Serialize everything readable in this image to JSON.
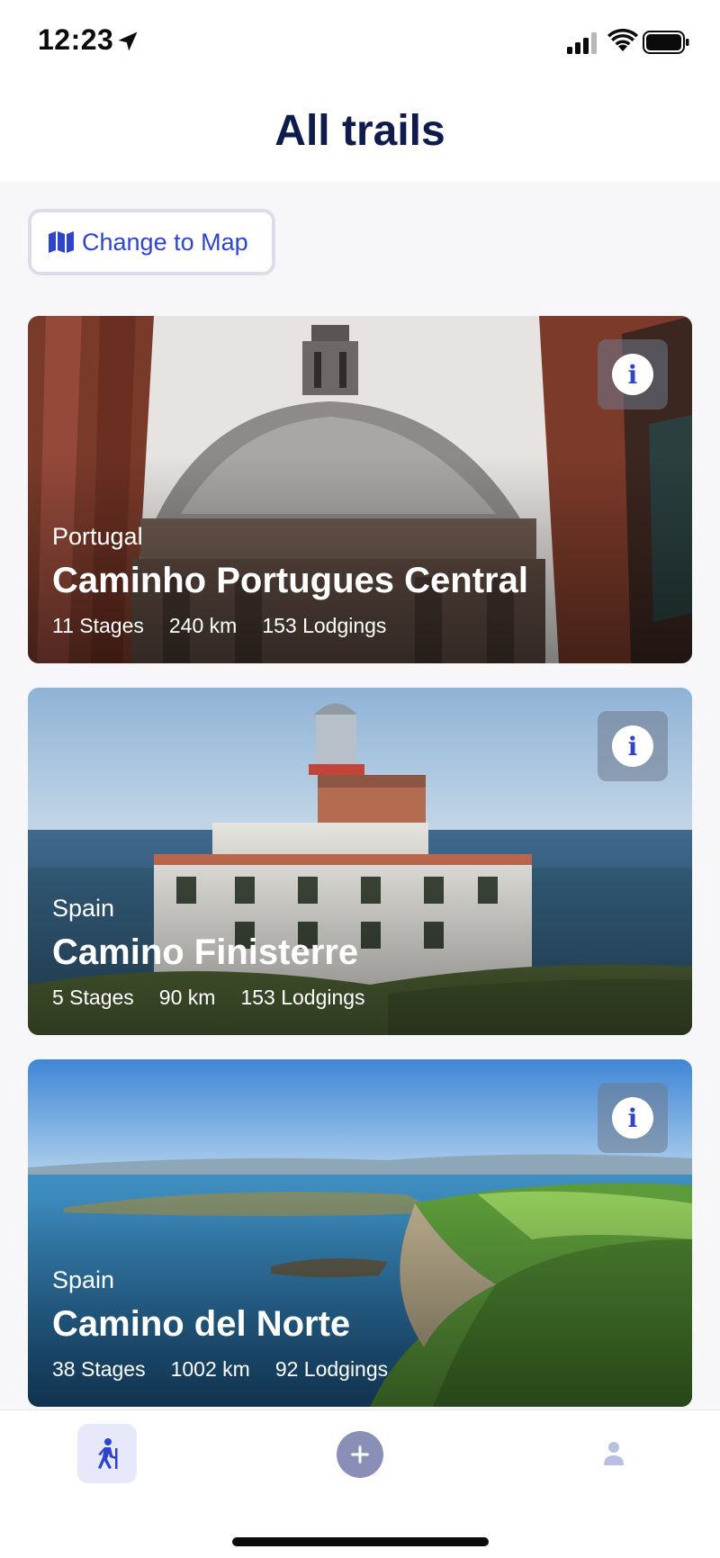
{
  "status_bar": {
    "time": "12:23",
    "icons": [
      "location-arrow-icon",
      "signal-icon",
      "wifi-icon",
      "battery-icon"
    ]
  },
  "header": {
    "title": "All trails"
  },
  "map_toggle": {
    "label": "Change to Map",
    "icon": "map-icon"
  },
  "trails": [
    {
      "country": "Portugal",
      "name": "Caminho Portugues Central",
      "stages": "11 Stages",
      "distance": "240 km",
      "lodgings": "153 Lodgings",
      "info_label": "i"
    },
    {
      "country": "Spain",
      "name": "Camino Finisterre",
      "stages": "5 Stages",
      "distance": "90 km",
      "lodgings": "153 Lodgings",
      "info_label": "i"
    },
    {
      "country": "Spain",
      "name": "Camino del Norte",
      "stages": "38 Stages",
      "distance": "1002 km",
      "lodgings": "92 Lodgings",
      "info_label": "i"
    }
  ],
  "bottom_nav": {
    "items": [
      "hiker-icon",
      "plus-icon",
      "person-icon"
    ],
    "active": "hiker-icon"
  },
  "colors": {
    "accent": "#2f45c8",
    "title": "#0f1b4d",
    "background": "#f7f7fa",
    "nav_active_bg": "#e7e9fb",
    "add_button": "#8a8fb8"
  }
}
